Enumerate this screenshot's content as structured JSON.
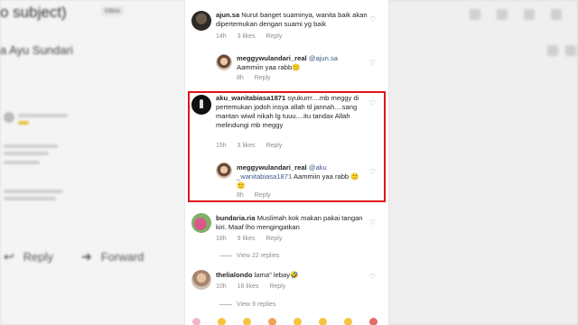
{
  "background": {
    "subject": "o subject)",
    "subject_badge": "Inbox",
    "sender": "a Ayu Sundari",
    "reply_label": "Reply",
    "forward_label": "Forward"
  },
  "comments": [
    {
      "username": "ajun.sa",
      "text": "Nurut banget suaminya, wanita baik akan dipertemukan dengan suami yg baik",
      "time": "14h",
      "likes": "3 likes",
      "reply": "Reply"
    },
    {
      "username": "meggywulandari_real",
      "mention": "@ajun.sa",
      "text": "Aammiin yaa rabb",
      "emoji": "🙂",
      "time": "8h",
      "likes": "",
      "reply": "Reply"
    },
    {
      "username": "aku_wanitabiasa1871",
      "text": "syukurrr....mb meggy di pertemukan jodoh insya allah til jannah....sang mantan wiwil nikah lg tuuu....itu tandax Allah melindungi mb meggy",
      "time": "15h",
      "likes": "3 likes",
      "reply": "Reply"
    },
    {
      "username": "meggywulandari_real",
      "mention": "@aku _wanitabiasa1871",
      "text": "Aammiin yaa rabb",
      "emoji": "🙂🙂",
      "time": "8h",
      "likes": "",
      "reply": "Reply"
    },
    {
      "username": "bundaria.ria",
      "text": "Muslimah kok makan pakai tangan kiri. Maaf lho mengingatkan",
      "time": "18h",
      "likes": "9 likes",
      "reply": "Reply"
    },
    {
      "username": "thelialondo",
      "text": "lama\" lebay",
      "emoji": "🤣",
      "time": "10h",
      "likes": "16 likes",
      "reply": "Reply"
    }
  ],
  "view_replies": [
    "View 22 replies",
    "View 9 replies"
  ],
  "colors": {
    "highlight": "#e1141b",
    "link": "#3a5a87",
    "meta": "#8e8e8e"
  }
}
